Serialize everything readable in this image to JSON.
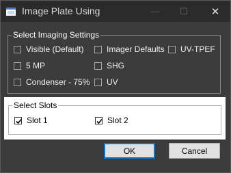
{
  "window": {
    "title": "Image Plate Using",
    "controls": {
      "minimize": "—",
      "maximize": "☐",
      "close": "✕"
    }
  },
  "imaging": {
    "title": "Select Imaging Settings",
    "options": [
      {
        "label": "Visible (Default)",
        "checked": false
      },
      {
        "label": "Imager Defaults",
        "checked": false
      },
      {
        "label": "UV-TPEF",
        "checked": false
      },
      {
        "label": "5 MP",
        "checked": false
      },
      {
        "label": "SHG",
        "checked": false
      },
      {
        "label": "Condenser - 75%",
        "checked": false
      },
      {
        "label": "UV",
        "checked": false
      }
    ]
  },
  "slots": {
    "title": "Select Slots",
    "options": [
      {
        "label": "Slot 1",
        "checked": true
      },
      {
        "label": "Slot 2",
        "checked": true
      }
    ]
  },
  "buttons": {
    "ok": "OK",
    "cancel": "Cancel"
  },
  "colors": {
    "accent": "#0078d7",
    "window_bg": "#3c3c3c",
    "titlebar_bg": "#2b2b2b"
  }
}
